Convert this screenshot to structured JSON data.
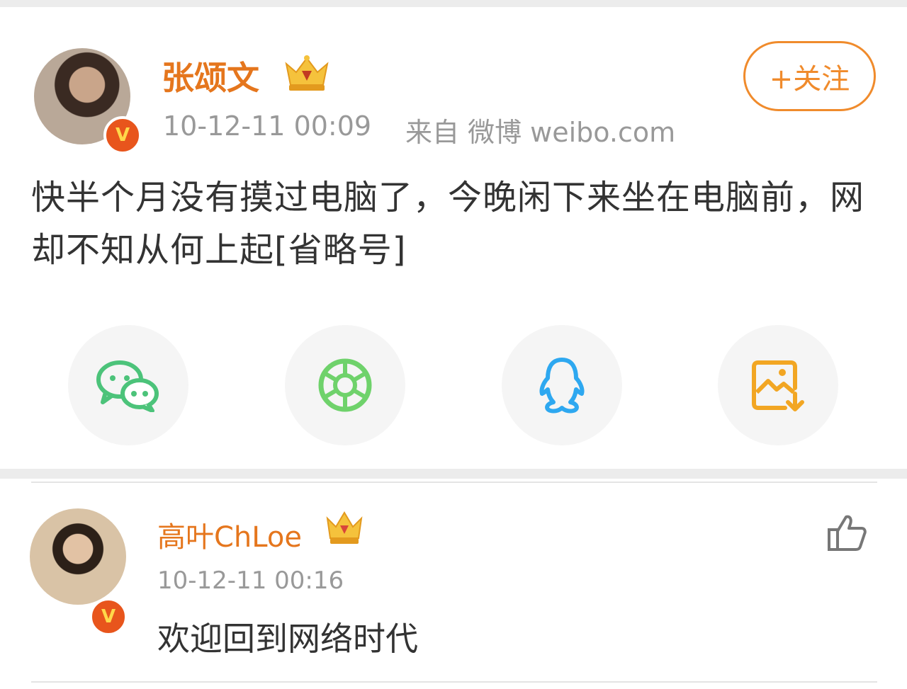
{
  "post": {
    "author": "张颂文",
    "timestamp": "10-12-11 00:09",
    "source": "来自 微博 weibo.com",
    "follow_label": "+关注",
    "text": "快半个月没有摸过电脑了，今晚闲下来坐在电脑前，网却不知从何上起[省略号]",
    "verified_mark": "V"
  },
  "share": {
    "items": [
      {
        "name": "wechat",
        "icon": "wechat-icon",
        "color": "#4cc37a"
      },
      {
        "name": "moments",
        "icon": "moments-shutter-icon",
        "color": "#6fd26b"
      },
      {
        "name": "qq",
        "icon": "qq-penguin-icon",
        "color": "#2ea8f0"
      },
      {
        "name": "save-image",
        "icon": "save-image-icon",
        "color": "#f2a623"
      }
    ]
  },
  "comment": {
    "author": "高叶ChLoe",
    "timestamp": "10-12-11 00:16",
    "text": "欢迎回到网络时代",
    "verified_mark": "V",
    "like_icon": "thumbs-up-icon"
  },
  "colors": {
    "username": "#e5761d",
    "follow": "#f08b2c",
    "meta": "#999999",
    "verified": "#e8551c"
  }
}
